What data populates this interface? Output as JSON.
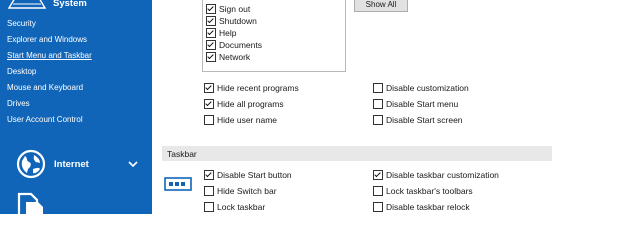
{
  "sidebar": {
    "system_label": "System",
    "items": [
      {
        "label": "Security"
      },
      {
        "label": "Explorer and Windows"
      },
      {
        "label": "Start Menu and Taskbar",
        "active": true
      },
      {
        "label": "Desktop"
      },
      {
        "label": "Mouse and Keyboard"
      },
      {
        "label": "Drives"
      },
      {
        "label": "User Account Control"
      }
    ],
    "internet_label": "Internet"
  },
  "listbox": {
    "items": [
      {
        "label": "Sign out",
        "checked": true
      },
      {
        "label": "Shutdown",
        "checked": true
      },
      {
        "label": "Help",
        "checked": true
      },
      {
        "label": "Documents",
        "checked": true
      },
      {
        "label": "Network",
        "checked": true
      }
    ]
  },
  "show_all_label": "Show All",
  "start_options": {
    "col1": [
      {
        "label": "Hide recent programs",
        "checked": true
      },
      {
        "label": "Hide all programs",
        "checked": true
      },
      {
        "label": "Hide user name",
        "checked": false
      }
    ],
    "col2": [
      {
        "label": "Disable customization",
        "checked": false
      },
      {
        "label": "Disable Start menu",
        "checked": false
      },
      {
        "label": "Disable Start screen",
        "checked": false
      }
    ]
  },
  "taskbar": {
    "title": "Taskbar",
    "col1": [
      {
        "label": "Disable Start button",
        "checked": true
      },
      {
        "label": "Hide Switch bar",
        "checked": false
      },
      {
        "label": "Lock taskbar",
        "checked": false
      }
    ],
    "col2": [
      {
        "label": "Disable taskbar customization",
        "checked": true
      },
      {
        "label": "Lock taskbar's toolbars",
        "checked": false
      },
      {
        "label": "Disable taskbar relock",
        "checked": false
      }
    ]
  },
  "colors": {
    "sidebar": "#1165b8",
    "section_bg": "#e8e8e8"
  },
  "icons": [
    "system-icon",
    "globe-icon",
    "chevron-down-icon",
    "document-icon",
    "taskbar-icon"
  ]
}
